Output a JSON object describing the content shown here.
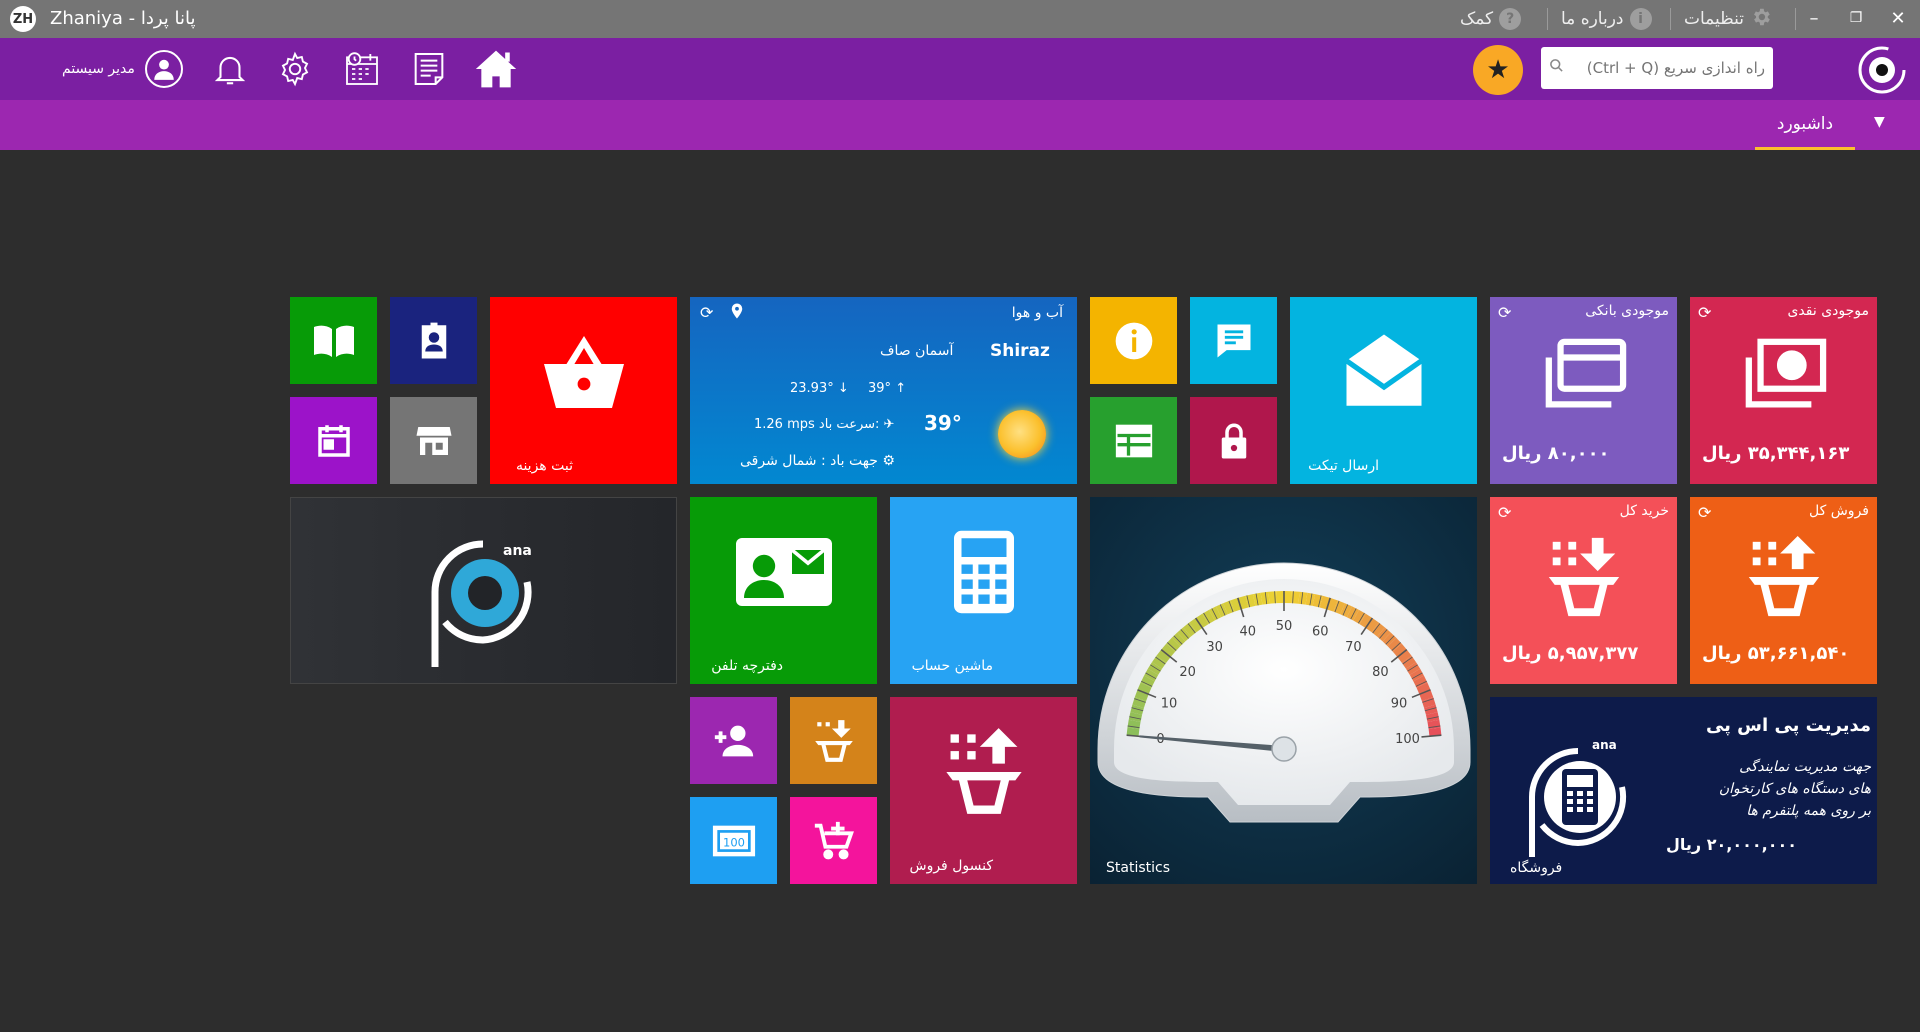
{
  "window": {
    "title": "Zhaniya - پانا پردا",
    "menu": [
      {
        "label": "کمک",
        "icon": "help-icon"
      },
      {
        "label": "درباره ما",
        "icon": "info-icon"
      },
      {
        "label": "تنظیمات",
        "icon": "gear-icon"
      }
    ]
  },
  "toolbar": {
    "user_name": "مدیر سیستم",
    "search_placeholder": "راه اندازی سریع (Ctrl + Q)"
  },
  "tabs": [
    {
      "label": "داشبورد",
      "active": true
    }
  ],
  "tiles": {
    "expense": {
      "label": "ثبت هزینه",
      "color": "#ff0000"
    },
    "ticket": {
      "label": "ارسال تیکت",
      "color": "#03b4e0"
    },
    "phonebook": {
      "label": "دفترچه تلفن",
      "color": "#079b07"
    },
    "calculator": {
      "label": "ماشین حساب",
      "color": "#27a3f3"
    },
    "sales_console": {
      "label": "کنسول فروش",
      "color": "#b01d4f"
    },
    "statistics": {
      "label": "Statistics",
      "color": "#0a2b3e"
    },
    "bank_balance": {
      "title": "موجودی بانکی",
      "amount": "۸۰,۰۰۰ ریال",
      "color": "#7d5bbf"
    },
    "cash_balance": {
      "title": "موجودی نقدی",
      "amount": "۳۵,۳۴۴,۱۶۳ ریال",
      "color": "#d32751"
    },
    "total_purchase": {
      "title": "خرید کل",
      "amount": "۵,۹۵۷,۳۷۷ ریال",
      "color": "#f45058"
    },
    "total_sales": {
      "title": "فروش کل",
      "amount": "۵۳,۶۶۱,۵۴۰ ریال",
      "color": "#ee5f16"
    },
    "pos": {
      "title": "مدیریت پی اس پی",
      "desc_lines": [
        "جهت مدیریت نمایندگی",
        "های دستگاه های کارتخوان",
        "بر روی همه پلتفرم ها"
      ],
      "amount": "۲۰,۰۰۰,۰۰۰ ریال",
      "label": "فروشگاه",
      "logo_text": "ana",
      "color": "#0d1b4a"
    },
    "brand": {
      "logo_text": "ana"
    }
  },
  "weather": {
    "title": "آب و هوا",
    "condition": "آسمان صاف",
    "city": "Shiraz",
    "temp_min": "23.93°",
    "temp_max": "39°",
    "temp": "39°",
    "wind_speed_label": "سرعت باد",
    "wind_speed": "1.26 mps",
    "wind_dir": "جهت باد : شمال شرقی"
  },
  "gauge": {
    "value": 0,
    "min": 0,
    "max": 100,
    "ticks": [
      "0",
      "10",
      "20",
      "30",
      "40",
      "50",
      "60",
      "70",
      "80",
      "90",
      "100"
    ]
  },
  "colors": {
    "titlebar": "#757575",
    "toolbar": "#7b1fa2",
    "tabbar": "#9c27b0",
    "accent": "#fbc02d"
  }
}
